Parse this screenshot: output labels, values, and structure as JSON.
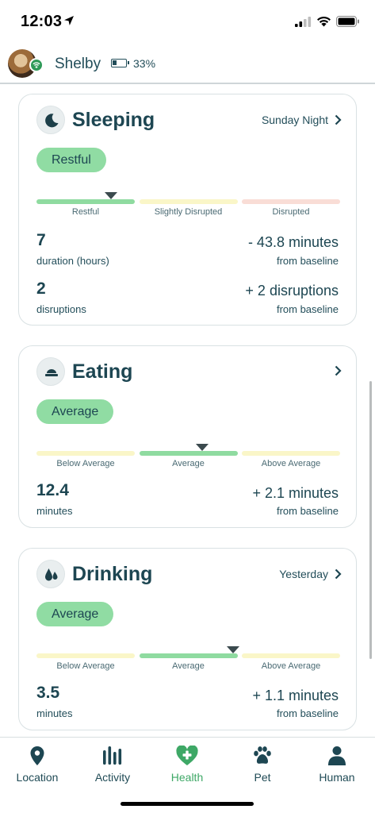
{
  "status_bar": {
    "time": "12:03"
  },
  "header": {
    "pet_name": "Shelby",
    "battery_percent": "33%",
    "battery_level": 0.33
  },
  "cards": [
    {
      "title": "Sleeping",
      "link": "Sunday Night",
      "status": "Restful",
      "scale_labels": [
        "Restful",
        "Slightly Disrupted",
        "Disrupted"
      ],
      "scale_colors": [
        "#8fdba0",
        "#faf6c8",
        "#f9ddd6"
      ],
      "marker_position": 0.245,
      "metrics": [
        {
          "value": "7",
          "unit": "duration (hours)",
          "diff": "- 43.8 minutes",
          "baseline": "from baseline"
        },
        {
          "value": "2",
          "unit": "disruptions",
          "diff": "+ 2 disruptions",
          "baseline": "from baseline"
        }
      ]
    },
    {
      "title": "Eating",
      "link": "",
      "status": "Average",
      "scale_labels": [
        "Below Average",
        "Average",
        "Above Average"
      ],
      "scale_colors": [
        "#faf6c8",
        "#8fdba0",
        "#faf6c8"
      ],
      "marker_position": 0.545,
      "metrics": [
        {
          "value": "12.4",
          "unit": "minutes",
          "diff": "+ 2.1 minutes",
          "baseline": "from baseline"
        }
      ]
    },
    {
      "title": "Drinking",
      "link": "Yesterday",
      "status": "Average",
      "scale_labels": [
        "Below Average",
        "Average",
        "Above Average"
      ],
      "scale_colors": [
        "#faf6c8",
        "#8fdba0",
        "#faf6c8"
      ],
      "marker_position": 0.648,
      "metrics": [
        {
          "value": "3.5",
          "unit": "minutes",
          "diff": "+ 1.1 minutes",
          "baseline": "from baseline"
        }
      ]
    }
  ],
  "tabs": [
    {
      "label": "Location",
      "icon": "location-pin-icon",
      "active": false
    },
    {
      "label": "Activity",
      "icon": "activity-bars-icon",
      "active": false
    },
    {
      "label": "Health",
      "icon": "health-heart-icon",
      "active": true
    },
    {
      "label": "Pet",
      "icon": "paw-icon",
      "active": false
    },
    {
      "label": "Human",
      "icon": "person-icon",
      "active": false
    }
  ],
  "colors": {
    "accent": "#3ea866",
    "text": "#1d4652",
    "pill": "#90dca3"
  }
}
